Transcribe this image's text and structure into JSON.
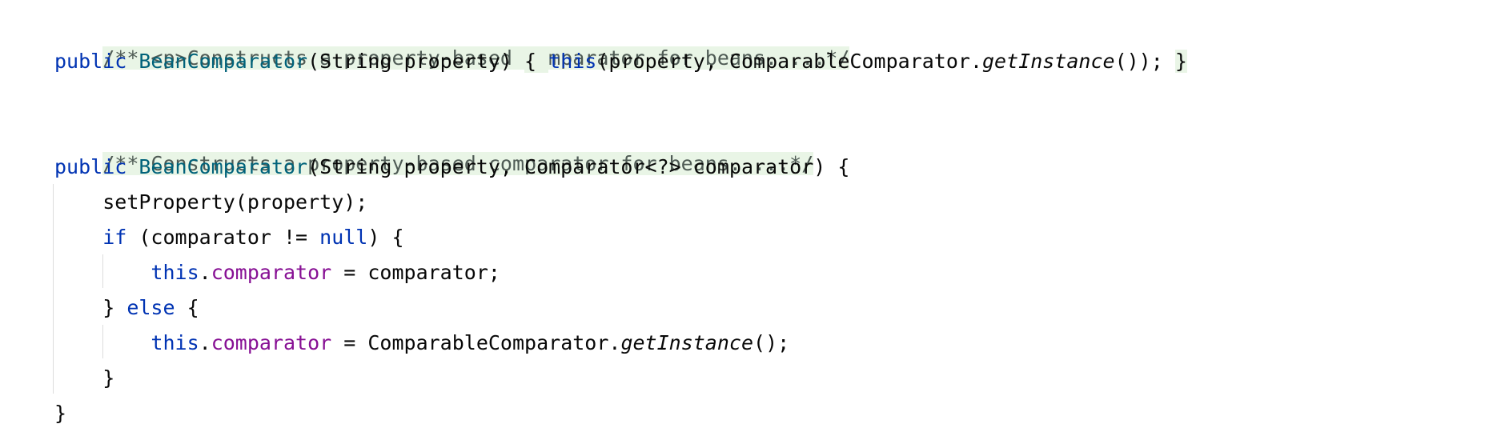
{
  "code": {
    "line1": {
      "comment": "/** <p>Constructs a property-based comparator for beans. ...*/"
    },
    "line2": {
      "kw_public": "public",
      "ctor_name": "BeanComparator",
      "params": "(String property)",
      "gap1": " ",
      "fold_open": "{ ",
      "kw_this": "this",
      "args_a": "(property, ComparableComparator.",
      "method": "getInstance",
      "args_b": "());",
      "gap2": " ",
      "fold_close": "}"
    },
    "line4": {
      "comment": "/** Constructs a property-based comparator for beans. ...*/"
    },
    "line5": {
      "kw_public": "public",
      "ctor_name": "BeanComparator",
      "params": "(String property, Comparator<?> comparator) {"
    },
    "line6": {
      "indent": "    ",
      "stmt": "setProperty(property);"
    },
    "line7": {
      "indent": "    ",
      "kw_if": "if",
      "cond": " (comparator != ",
      "kw_null": "null",
      "tail": ") {"
    },
    "line8": {
      "indent": "        ",
      "kw_this": "this",
      "dot": ".",
      "field": "comparator",
      "rest": " = comparator;"
    },
    "line9": {
      "indent": "    ",
      "brace": "} ",
      "kw_else": "else",
      "tail": " {"
    },
    "line10": {
      "indent": "        ",
      "kw_this": "this",
      "dot": ".",
      "field": "comparator",
      "rest": " = ComparableComparator.",
      "method": "getInstance",
      "tail": "();"
    },
    "line11": {
      "indent": "    ",
      "brace": "}"
    },
    "line12": {
      "brace": "}"
    }
  }
}
